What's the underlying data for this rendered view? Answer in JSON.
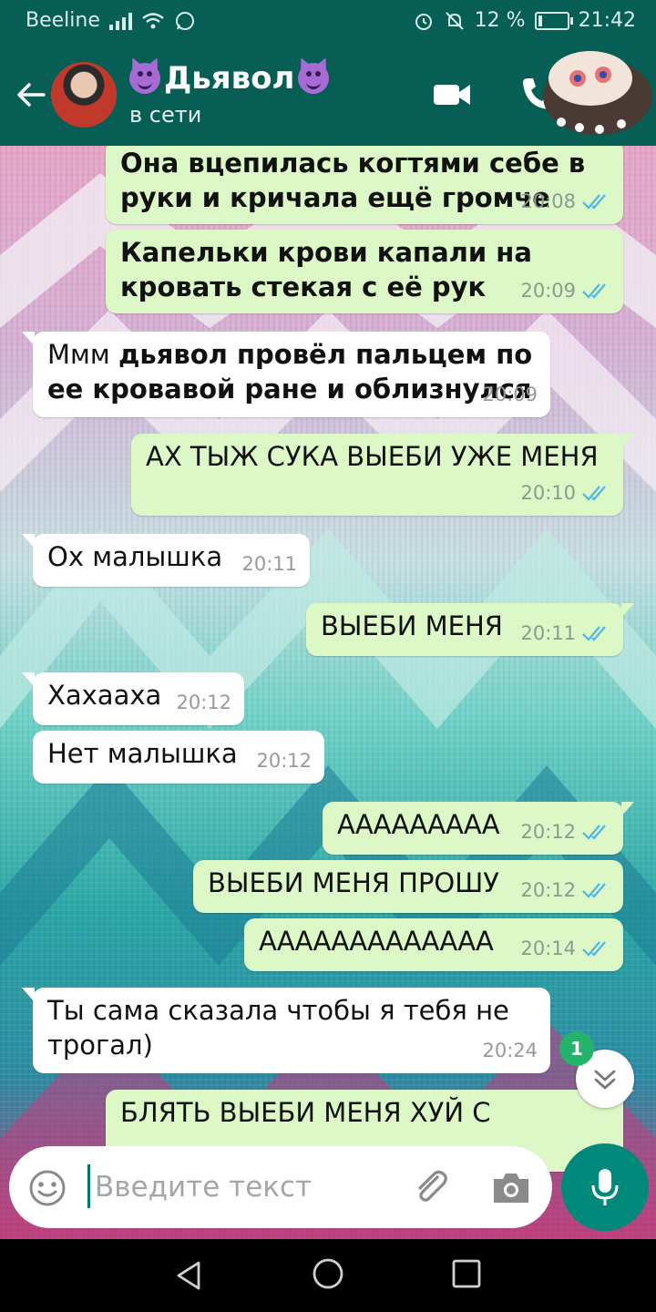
{
  "status_bar": {
    "carrier": "Beeline",
    "battery": "12 %",
    "battery_level": 0.12,
    "time": "21:42"
  },
  "header": {
    "contact_name": "Дьявол",
    "contact_status": "в сети"
  },
  "messages": [
    {
      "dir": "out",
      "text": "Она вцепилась когтями себе в руки и кричала ещё громче",
      "bold": true,
      "time": "20:08",
      "read": true
    },
    {
      "dir": "out",
      "text": "Капельки крови капали на кровать стекая с её рук",
      "bold": true,
      "time": "20:09",
      "read": true
    },
    {
      "dir": "in",
      "text_plain": "Ммм ",
      "text_bold": "дьявол провёл пальцем по ее кровавой ране и облизнулся",
      "time": "20:09"
    },
    {
      "dir": "out",
      "text": "АХ ТЫЖ СУКА ВЫЕБИ УЖЕ МЕНЯ",
      "time": "20:10",
      "read": true
    },
    {
      "dir": "in",
      "text": "Ох малышка",
      "time": "20:11"
    },
    {
      "dir": "out",
      "text": "ВЫЕБИ МЕНЯ",
      "time": "20:11",
      "read": true
    },
    {
      "dir": "in",
      "text": "Хахааха",
      "time": "20:12"
    },
    {
      "dir": "in",
      "text": "Нет малышка",
      "time": "20:12"
    },
    {
      "dir": "out",
      "text": "ААААААААА",
      "time": "20:12",
      "read": true
    },
    {
      "dir": "out",
      "text": "ВЫЕБИ МЕНЯ ПРОШУ",
      "time": "20:12",
      "read": true
    },
    {
      "dir": "out",
      "text": "ААААААААААААА",
      "time": "20:14",
      "read": true
    },
    {
      "dir": "in",
      "text": "Ты сама сказала чтобы я тебя не трогал)",
      "time": "20:24"
    },
    {
      "dir": "out",
      "text": "БЛЯТЬ ВЫЕБИ МЕНЯ ХУЙ С",
      "time": ""
    }
  ],
  "unread_count": "1",
  "input": {
    "placeholder": "Введите текст"
  },
  "icons": {
    "back": "arrow-left-icon",
    "video": "video-call-icon",
    "call": "phone-icon",
    "emoji": "emoji-icon",
    "attach": "paperclip-icon",
    "camera": "camera-icon",
    "mic": "microphone-icon",
    "scroll": "chevron-double-down-icon"
  },
  "colors": {
    "header": "#075e54",
    "outgoing_bubble": "#dcf8c6",
    "incoming_bubble": "#ffffff",
    "read_ticks": "#4fb6ec",
    "mic_button": "#00897b",
    "unread_badge": "#25b36b"
  }
}
